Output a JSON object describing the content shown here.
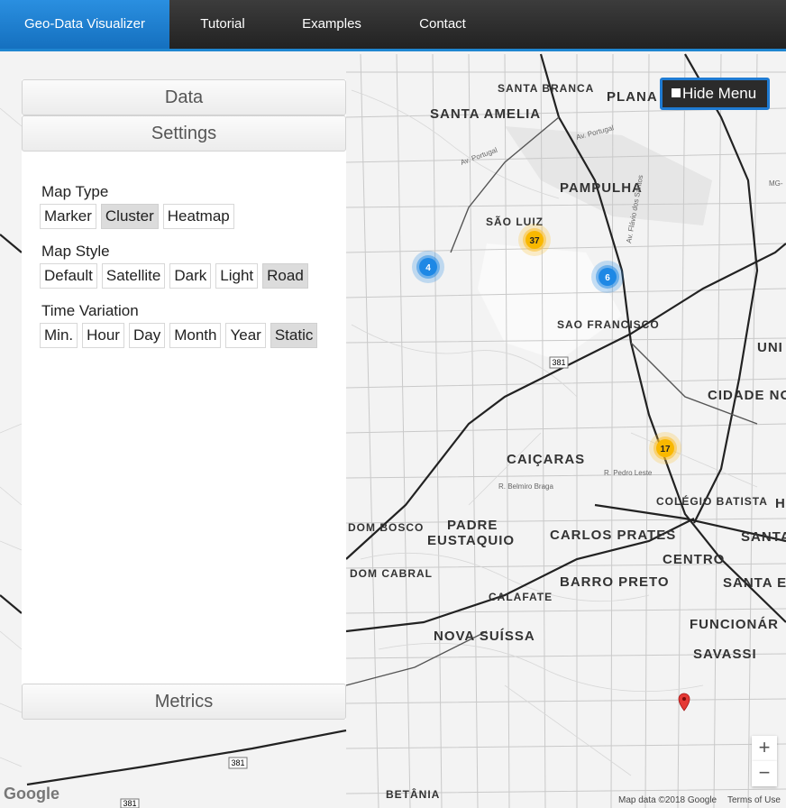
{
  "nav": {
    "brand": "Geo-Data Visualizer",
    "items": [
      "Tutorial",
      "Examples",
      "Contact"
    ]
  },
  "panel": {
    "data_header": "Data",
    "settings_header": "Settings",
    "metrics_header": "Metrics",
    "groups": [
      {
        "label": "Map Type",
        "options": [
          "Marker",
          "Cluster",
          "Heatmap"
        ],
        "selected": "Cluster"
      },
      {
        "label": "Map Style",
        "options": [
          "Default",
          "Satellite",
          "Dark",
          "Light",
          "Road"
        ],
        "selected": "Road"
      },
      {
        "label": "Time Variation",
        "options": [
          "Min.",
          "Hour",
          "Day",
          "Month",
          "Year",
          "Static"
        ],
        "selected": "Static"
      }
    ]
  },
  "hide_menu": {
    "label": "Hide Menu"
  },
  "map": {
    "places": [
      "SANTA BRANCA",
      "SANTA AMELIA",
      "PLANA",
      "PAMPULHA",
      "SÃO LUIZ",
      "SAO FRANCISCO",
      "UNI",
      "CIDADE NO",
      "CAIÇARAS",
      "COLÉGIO BATISTA",
      "H",
      "DOM BOSCO",
      "PADRE",
      "EUSTAQUIO",
      "CARLOS PRATES",
      "SANTA",
      "DOM CABRAL",
      "CENTRO",
      "BARRO PRETO",
      "SANTA E",
      "CALAFATE",
      "FUNCIONÁR",
      "NOVA SUÍSSA",
      "SAVASSI",
      "BETÂNIA"
    ],
    "roads": [
      "Av. Portugal",
      "Av. Portugal",
      "381",
      "381",
      "381",
      "R. Pedro Leste",
      "R. Belmiro Braga",
      "Av. Flávio dos Santos",
      "MG-"
    ],
    "clusters": [
      {
        "count": "4",
        "color": "#1e88e5"
      },
      {
        "count": "37",
        "color": "#fbc02d"
      },
      {
        "count": "6",
        "color": "#1e88e5"
      },
      {
        "count": "17",
        "color": "#fbc02d"
      }
    ],
    "marker_icon": "map-pin-icon",
    "zoom_in": "+",
    "zoom_out": "−",
    "attribution": "Map data ©2018 Google",
    "terms": "Terms of Use",
    "google_logo": "Google"
  },
  "colors": {
    "accent": "#1f86d0",
    "navbar": "#2a2a2a",
    "cluster_blue": "#1e88e5",
    "cluster_yellow": "#fbc02d",
    "marker_red": "#e53935"
  }
}
